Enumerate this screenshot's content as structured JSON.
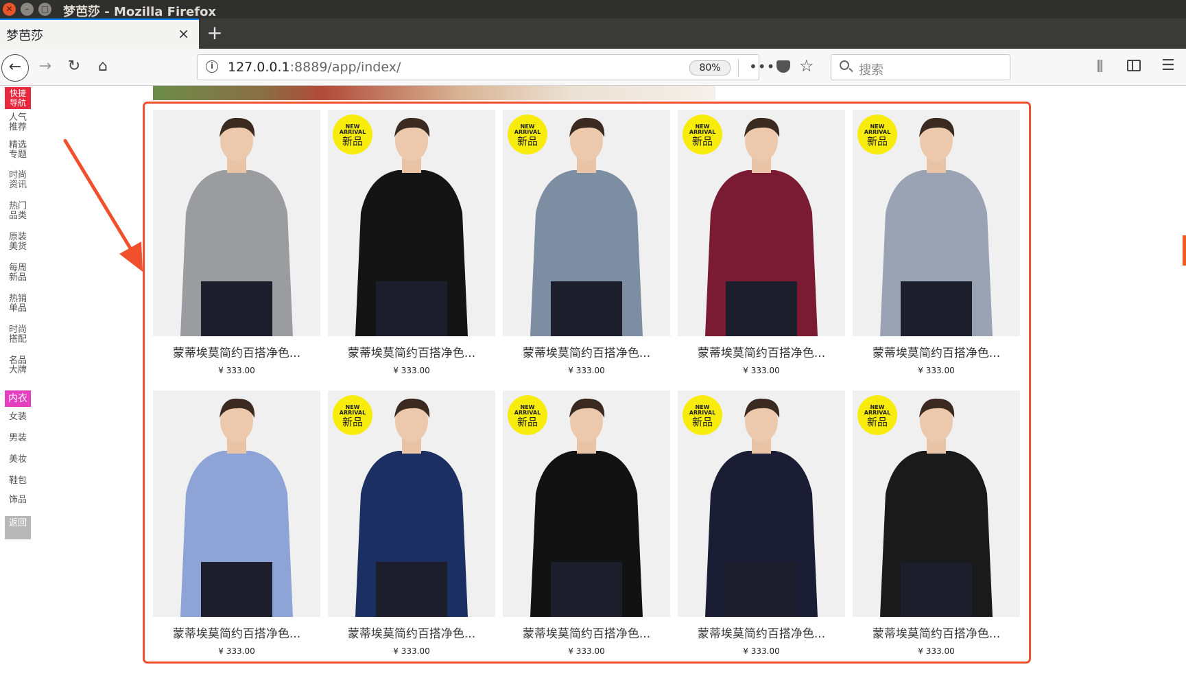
{
  "window": {
    "title": "梦芭莎 - Mozilla Firefox"
  },
  "tab": {
    "label": "梦芭莎",
    "close": "×",
    "new_tab": "+"
  },
  "toolbar": {
    "url_host": "127.0.0.1",
    "url_rest": ":8889/app/index/",
    "zoom": "80%",
    "page_actions": "•••",
    "search_placeholder": "搜索"
  },
  "left_nav": {
    "items": [
      {
        "label": "快捷导航",
        "style": "red"
      },
      {
        "label": "人气推荐"
      },
      {
        "label": "精选专题"
      },
      {
        "label": "时尚资讯"
      },
      {
        "label": "热门品类"
      },
      {
        "label": "原装美货"
      },
      {
        "label": "每周新品"
      },
      {
        "label": "热销单品"
      },
      {
        "label": "时尚搭配"
      },
      {
        "label": "名品大牌"
      },
      {
        "label": "内衣",
        "style": "pink"
      },
      {
        "label": "女装"
      },
      {
        "label": "男装"
      },
      {
        "label": "美妆"
      },
      {
        "label": "鞋包"
      },
      {
        "label": "饰品"
      },
      {
        "label": "返回",
        "style": "back"
      }
    ]
  },
  "badge": {
    "top": "NEW ARRIVAL",
    "main": "新品"
  },
  "products": [
    {
      "name": "蒙蒂埃莫简约百搭净色...",
      "price": "¥ 333.00",
      "badge": false,
      "shirt_color": "#9a9ca0"
    },
    {
      "name": "蒙蒂埃莫简约百搭净色...",
      "price": "¥ 333.00",
      "badge": true,
      "shirt_color": "#141414"
    },
    {
      "name": "蒙蒂埃莫简约百搭净色...",
      "price": "¥ 333.00",
      "badge": true,
      "shirt_color": "#7d8ea3"
    },
    {
      "name": "蒙蒂埃莫简约百搭净色...",
      "price": "¥ 333.00",
      "badge": true,
      "shirt_color": "#7a1a33"
    },
    {
      "name": "蒙蒂埃莫简约百搭净色...",
      "price": "¥ 333.00",
      "badge": true,
      "shirt_color": "#9aa3b3"
    },
    {
      "name": "蒙蒂埃莫简约百搭净色...",
      "price": "¥ 333.00",
      "badge": false,
      "shirt_color": "#8ea4d6"
    },
    {
      "name": "蒙蒂埃莫简约百搭净色...",
      "price": "¥ 333.00",
      "badge": true,
      "shirt_color": "#1c2f63"
    },
    {
      "name": "蒙蒂埃莫简约百搭净色...",
      "price": "¥ 333.00",
      "badge": true,
      "shirt_color": "#121212"
    },
    {
      "name": "蒙蒂埃莫简约百搭净色...",
      "price": "¥ 333.00",
      "badge": true,
      "shirt_color": "#1a1d33"
    },
    {
      "name": "蒙蒂埃莫简约百搭净色...",
      "price": "¥ 333.00",
      "badge": true,
      "shirt_color": "#1a1a1a"
    }
  ],
  "colors": {
    "accent": "#f0502c",
    "badge": "#f7ec0c",
    "nav_red": "#e8283c",
    "nav_pink": "#e33fbf"
  }
}
